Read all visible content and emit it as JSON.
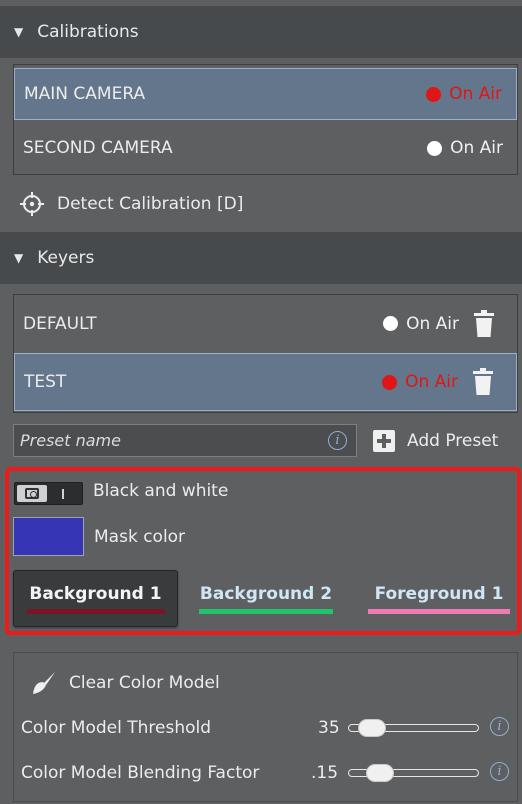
{
  "calibrations": {
    "header": "Calibrations",
    "items": [
      {
        "name": "MAIN CAMERA",
        "status": "On Air",
        "live": true
      },
      {
        "name": "SECOND CAMERA",
        "status": "On Air",
        "live": false
      }
    ],
    "detect_label": "Detect Calibration [D]"
  },
  "keyers": {
    "header": "Keyers",
    "items": [
      {
        "name": "DEFAULT",
        "status": "On Air",
        "live": false
      },
      {
        "name": "TEST",
        "status": "On Air",
        "live": true
      }
    ],
    "preset_placeholder": "Preset name",
    "add_preset_label": "Add Preset"
  },
  "options": {
    "black_white_label": "Black and white",
    "mask_color_label": "Mask color",
    "mask_color": "#3535b5",
    "layers": [
      {
        "label": "Background 1",
        "color": "#7a1527",
        "active": true
      },
      {
        "label": "Background 2",
        "color": "#21c46a",
        "active": false
      },
      {
        "label": "Foreground 1",
        "color": "#f07ab6",
        "active": false
      }
    ]
  },
  "color_model": {
    "clear_label": "Clear Color Model",
    "threshold_label": "Color Model Threshold",
    "threshold_value": "35",
    "blending_label": "Color Model Blending Factor",
    "blending_value": ".15"
  },
  "colors": {
    "live": "#e01515",
    "selection": "#63768b",
    "highlight_frame": "#ee1a1a",
    "info": "#8fb0d6"
  }
}
